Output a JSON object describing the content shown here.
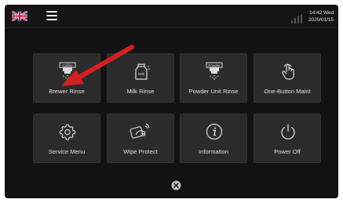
{
  "header": {
    "language_icon": "uk-flag-icon",
    "menu_icon": "hamburger-menu-icon",
    "signal_icon": "signal-bars-icon",
    "time": "14:42 Wed",
    "date": "2020/01/15"
  },
  "tiles": [
    {
      "label": "Brewer Rinse",
      "icon": "coffee-brewer-icon",
      "icon_text": "Coffee"
    },
    {
      "label": "Milk Rinse",
      "icon": "milk-carton-icon",
      "icon_text": "Milk"
    },
    {
      "label": "Powder Unit Rinse",
      "icon": "powder-unit-icon",
      "icon_text": "Powder"
    },
    {
      "label": "One-Button Maint",
      "icon": "touch-hand-icon"
    },
    {
      "label": "Service Menu",
      "icon": "gear-icon"
    },
    {
      "label": "Wipe Protect",
      "icon": "wipe-hand-icon"
    },
    {
      "label": "Information",
      "icon": "info-icon"
    },
    {
      "label": "Power Off",
      "icon": "power-icon"
    }
  ],
  "close_icon": "close-circle-icon",
  "colors": {
    "background": "#121212",
    "tile": "#2b2b2b",
    "arrow": "#d42020",
    "text": "#e2e2e2"
  }
}
